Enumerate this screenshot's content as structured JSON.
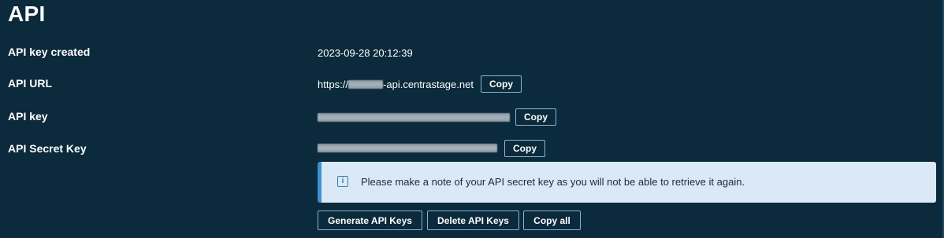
{
  "section": {
    "title": "API"
  },
  "rows": {
    "created": {
      "label": "API key created",
      "value": "2023-09-28 20:12:39"
    },
    "url": {
      "label": "API URL",
      "value_prefix": "https://",
      "value_suffix": "-api.centrastage.net",
      "copy_label": "Copy"
    },
    "key": {
      "label": "API key",
      "copy_label": "Copy"
    },
    "secret": {
      "label": "API Secret Key",
      "copy_label": "Copy"
    }
  },
  "notice": {
    "icon": "info-icon",
    "text": "Please make a note of your API secret key as you will not be able to retrieve it again."
  },
  "actions": {
    "generate": "Generate API Keys",
    "delete": "Delete API Keys",
    "copy_all": "Copy all"
  },
  "colors": {
    "background": "#0b2a3c",
    "notice_bg": "#dbe9f7",
    "notice_accent": "#3c92d1",
    "button_border": "#8ab4d0"
  }
}
